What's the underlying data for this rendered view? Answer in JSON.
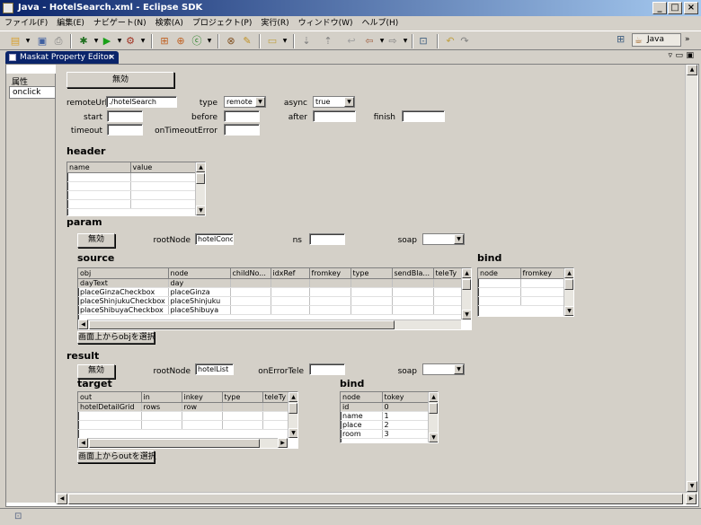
{
  "window": {
    "title": "Java - HotelSearch.xml - Eclipse SDK",
    "min": "_",
    "max": "□",
    "close": "×"
  },
  "menu": [
    "ファイル(F)",
    "編集(E)",
    "ナビゲート(N)",
    "検索(A)",
    "プロジェクト(P)",
    "実行(R)",
    "ウィンドウ(W)",
    "ヘルプ(H)"
  ],
  "perspective": {
    "label": "Java"
  },
  "editor": {
    "tab_label": "Maskat Property Editor",
    "tab_close": "×"
  },
  "left_panel": {
    "header": "属性",
    "items": [
      "onclick"
    ]
  },
  "top": {
    "disable_button": "無効",
    "remoteUrl_label": "remoteUrl",
    "remoteUrl_value": "./hotelSearch",
    "type_label": "type",
    "type_value": "remote",
    "async_label": "async",
    "async_value": "true",
    "start_label": "start",
    "start_value": "",
    "before_label": "before",
    "before_value": "",
    "after_label": "after",
    "after_value": "",
    "finish_label": "finish",
    "finish_value": "",
    "timeout_label": "timeout",
    "timeout_value": "",
    "onTimeoutError_label": "onTimeoutError",
    "onTimeoutError_value": ""
  },
  "header": {
    "title": "header",
    "columns": [
      "name",
      "value"
    ]
  },
  "param": {
    "title": "param",
    "disable_button": "無効",
    "rootNode_label": "rootNode",
    "rootNode_value": "hotelConc",
    "ns_label": "ns",
    "ns_value": "",
    "soap_label": "soap",
    "soap_value": "",
    "source": {
      "title": "source",
      "columns": [
        "obj",
        "node",
        "childNo...",
        "idxRef",
        "fromkey",
        "type",
        "sendBla...",
        "teleTy"
      ],
      "rows": [
        [
          "dayText",
          "day"
        ],
        [
          "placeGinzaCheckbox",
          "placeGinza"
        ],
        [
          "placeShinjukuCheckbox",
          "placeShinjuku"
        ],
        [
          "placeShibuyaCheckbox",
          "placeShibuya"
        ],
        [
          "",
          ""
        ]
      ],
      "select_button": "画面上からobjを選択"
    },
    "bind": {
      "title": "bind",
      "columns": [
        "node",
        "fromkey"
      ]
    }
  },
  "result": {
    "title": "result",
    "disable_button": "無効",
    "rootNode_label": "rootNode",
    "rootNode_value": "hotelList",
    "onErrorTele_label": "onErrorTele",
    "onErrorTele_value": "",
    "soap_label": "soap",
    "soap_value": "",
    "target": {
      "title": "target",
      "columns": [
        "out",
        "in",
        "inkey",
        "type",
        "teleTy"
      ],
      "rows": [
        [
          "hotelDetailGrid",
          "rows",
          "row",
          ""
        ]
      ],
      "select_button": "画面上からoutを選択"
    },
    "bind": {
      "title": "bind",
      "columns": [
        "node",
        "tokey"
      ],
      "rows": [
        [
          "id",
          "0"
        ],
        [
          "name",
          "1"
        ],
        [
          "place",
          "2"
        ],
        [
          "room",
          "3"
        ],
        [
          "",
          ""
        ]
      ]
    }
  }
}
